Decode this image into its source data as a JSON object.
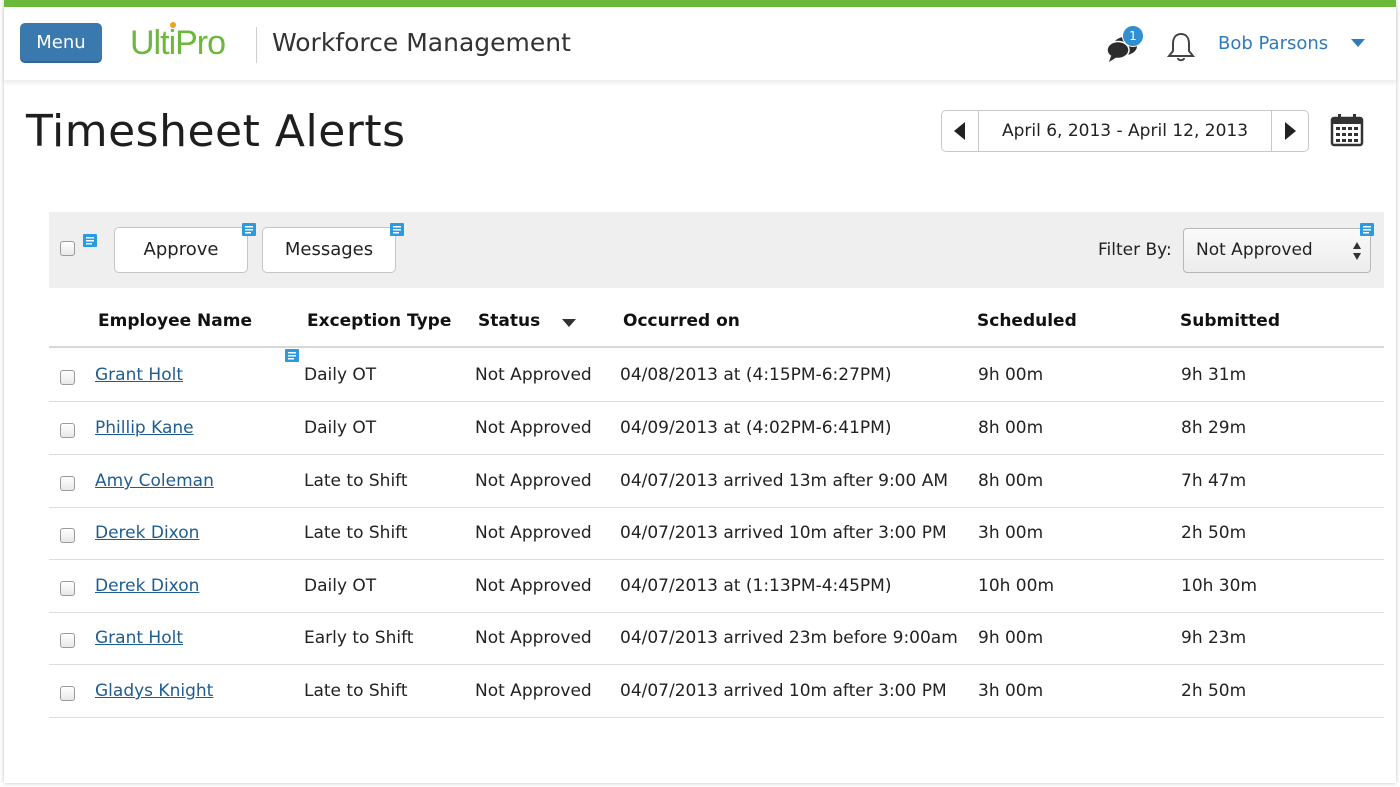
{
  "colors": {
    "brand_green": "#6bb83a",
    "menu_blue": "#3a79ad",
    "link_blue": "#1f5d91",
    "badge_blue": "#2f8fd0",
    "note_icon_blue": "#2a9be0"
  },
  "header": {
    "menu_label": "Menu",
    "logo_text": "UltiPro",
    "app_title": "Workforce Management",
    "messages_icon": "chat-bubbles-icon",
    "messages_badge": "1",
    "notifications_icon": "bell-icon",
    "user_name": "Bob Parsons",
    "user_menu_icon": "caret-down-icon"
  },
  "page": {
    "title": "Timesheet Alerts",
    "date_range": "April 6, 2013 -  April 12, 2013",
    "prev_icon": "triangle-left-icon",
    "next_icon": "triangle-right-icon",
    "calendar_icon": "calendar-icon"
  },
  "toolbar": {
    "approve_label": "Approve",
    "messages_label": "Messages",
    "filter_label": "Filter By:",
    "filter_value": "Not Approved",
    "filter_options_visible": [
      "Not Approved"
    ]
  },
  "table": {
    "columns": [
      "Employee Name",
      "Exception Type",
      "Status",
      "Occurred on",
      "Scheduled",
      "Submitted"
    ],
    "sorted_by": "Status",
    "rows": [
      {
        "name": "Grant Holt",
        "type": "Daily OT",
        "status": "Not Approved",
        "occurred": "04/08/2013 at (4:15PM-6:27PM)",
        "scheduled": "9h 00m",
        "submitted": "9h 31m"
      },
      {
        "name": "Phillip Kane",
        "type": "Daily OT",
        "status": "Not Approved",
        "occurred": "04/09/2013 at (4:02PM-6:41PM)",
        "scheduled": "8h 00m",
        "submitted": "8h 29m"
      },
      {
        "name": "Amy Coleman",
        "type": "Late to Shift",
        "status": "Not Approved",
        "occurred": "04/07/2013 arrived 13m after 9:00 AM",
        "scheduled": "8h 00m",
        "submitted": "7h 47m"
      },
      {
        "name": "Derek Dixon",
        "type": "Late to Shift",
        "status": "Not Approved",
        "occurred": "04/07/2013 arrived 10m after 3:00 PM",
        "scheduled": "3h 00m",
        "submitted": "2h 50m"
      },
      {
        "name": "Derek Dixon",
        "type": "Daily OT",
        "status": "Not Approved",
        "occurred": "04/07/2013 at (1:13PM-4:45PM)",
        "scheduled": "10h 00m",
        "submitted": "10h 30m"
      },
      {
        "name": "Grant Holt",
        "type": "Early to Shift",
        "status": "Not Approved",
        "occurred": "04/07/2013 arrived 23m before 9:00am",
        "scheduled": "9h 00m",
        "submitted": "9h 23m"
      },
      {
        "name": "Gladys Knight",
        "type": "Late to Shift",
        "status": "Not Approved",
        "occurred": "04/07/2013 arrived 10m after 3:00 PM",
        "scheduled": "3h 00m",
        "submitted": "2h 50m"
      }
    ]
  }
}
